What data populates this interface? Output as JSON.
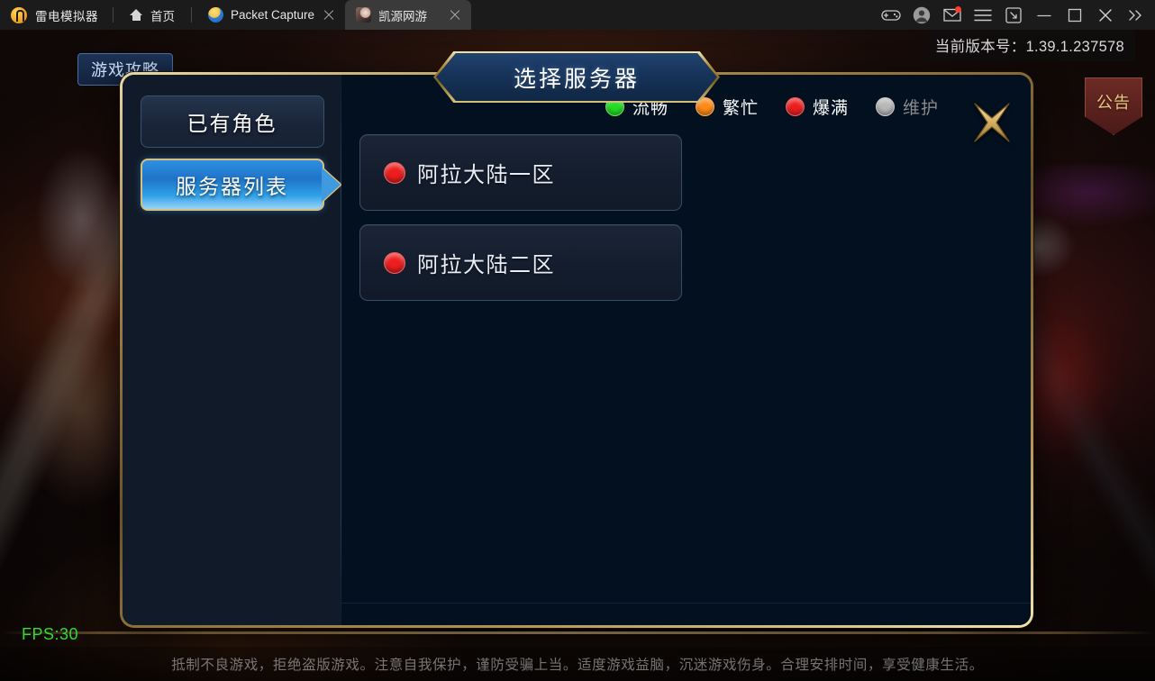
{
  "titlebar": {
    "brand": "雷电模拟器",
    "home_label": "首页",
    "tabs": [
      {
        "label": "Packet Capture",
        "icon": "packet-capture-icon",
        "active": false
      },
      {
        "label": "凯源网游",
        "icon": "game-app-icon",
        "active": true
      }
    ],
    "actions": [
      {
        "name": "gamepad-icon",
        "label": "手柄"
      },
      {
        "name": "user-avatar-icon",
        "label": "账号"
      },
      {
        "name": "mail-icon",
        "label": "消息",
        "badge": true
      },
      {
        "name": "menu-icon",
        "label": "菜单"
      },
      {
        "name": "screenshot-icon",
        "label": "截图"
      },
      {
        "name": "minimize-icon",
        "label": "最小化"
      },
      {
        "name": "maximize-icon",
        "label": "最大化"
      },
      {
        "name": "close-icon",
        "label": "关闭"
      },
      {
        "name": "expand-icon",
        "label": "展开"
      }
    ]
  },
  "hud": {
    "version": "当前版本号：1.39.1.237578",
    "guide_button": "游戏攻略",
    "notice_button": "公告",
    "fps": "FPS:30",
    "disclaimer": "抵制不良游戏，拒绝盗版游戏。注意自我保护，谨防受骗上当。适度游戏益脑，沉迷游戏伤身。合理安排时间，享受健康生活。"
  },
  "dialog": {
    "title": "选择服务器",
    "close_label": "关闭",
    "sidebar": [
      {
        "label": "已有角色",
        "active": false
      },
      {
        "label": "服务器列表",
        "active": true
      }
    ],
    "legend": [
      {
        "label": "流畅",
        "color": "#22dd22",
        "text_color": "#ffffff"
      },
      {
        "label": "繁忙",
        "color": "#ff8a14",
        "text_color": "#ffffff"
      },
      {
        "label": "爆满",
        "color": "#ef1d1d",
        "text_color": "#ffffff"
      },
      {
        "label": "维护",
        "color": "#b8b8b8",
        "text_color": "#8a8a8a"
      }
    ],
    "servers": [
      {
        "name": "阿拉大陆一区",
        "status": "爆满",
        "color": "#ef1d1d"
      },
      {
        "name": "阿拉大陆二区",
        "status": "爆满",
        "color": "#ef1d1d"
      }
    ]
  }
}
